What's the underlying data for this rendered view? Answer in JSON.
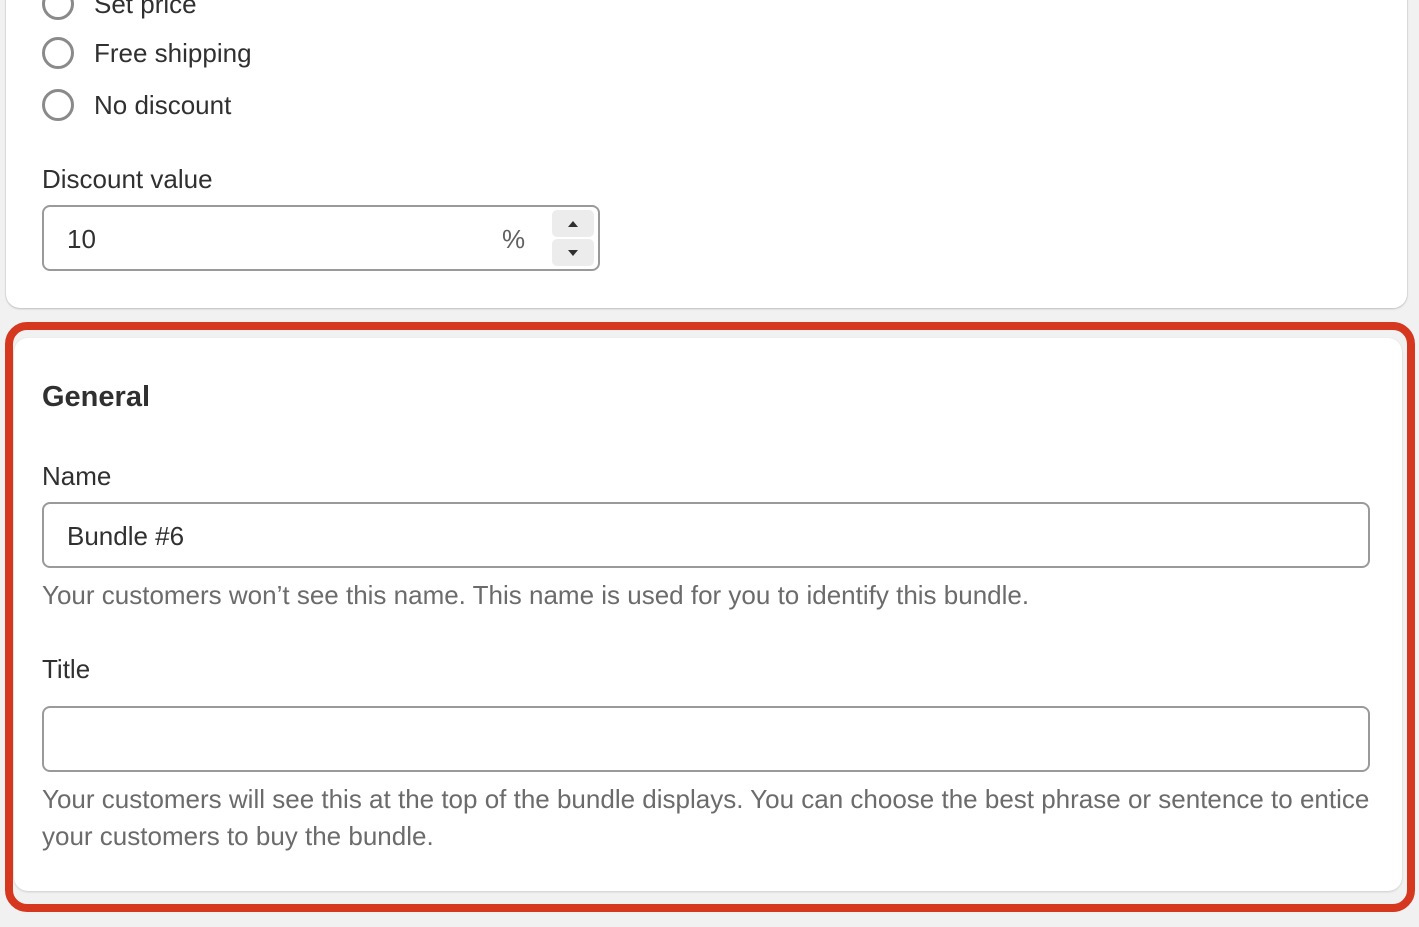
{
  "discount_type": {
    "options": [
      {
        "label": "Set price",
        "selected": false
      },
      {
        "label": "Free shipping",
        "selected": false
      },
      {
        "label": "No discount",
        "selected": false
      }
    ]
  },
  "discount_value": {
    "label": "Discount value",
    "value": "10",
    "suffix": "%"
  },
  "general": {
    "heading": "General",
    "name": {
      "label": "Name",
      "value": "Bundle #6",
      "help": "Your customers won’t see this name. This name is used for you to identify this bundle."
    },
    "title": {
      "label": "Title",
      "value": "",
      "help": "Your customers will see this at the top of the bundle displays. You can choose the best phrase or sentence to entice your customers to buy the bundle."
    }
  },
  "colors": {
    "highlight": "#d5381f",
    "background": "#f1f1f1",
    "card": "#ffffff"
  }
}
